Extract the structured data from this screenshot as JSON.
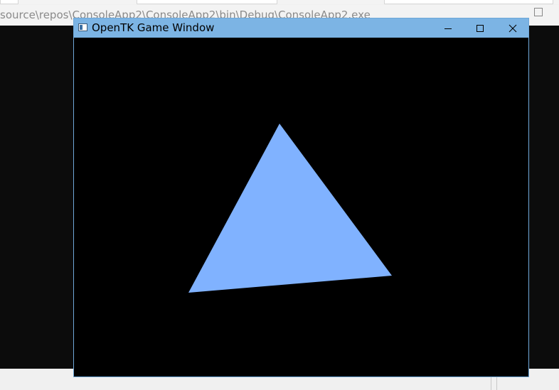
{
  "background_window": {
    "title": "source\\repos\\ConsoleApp2\\ConsoleApp2\\bin\\Debug\\ConsoleApp2.exe",
    "console_color": "#0c0c0c"
  },
  "game_window": {
    "title": "OpenTK Game Window",
    "icon": "app-icon",
    "controls": {
      "minimize_icon": "minimize-icon",
      "maximize_icon": "maximize-icon",
      "close_icon": "close-icon"
    },
    "clear_color": "#000000",
    "triangle_color": "#80b2ff"
  }
}
